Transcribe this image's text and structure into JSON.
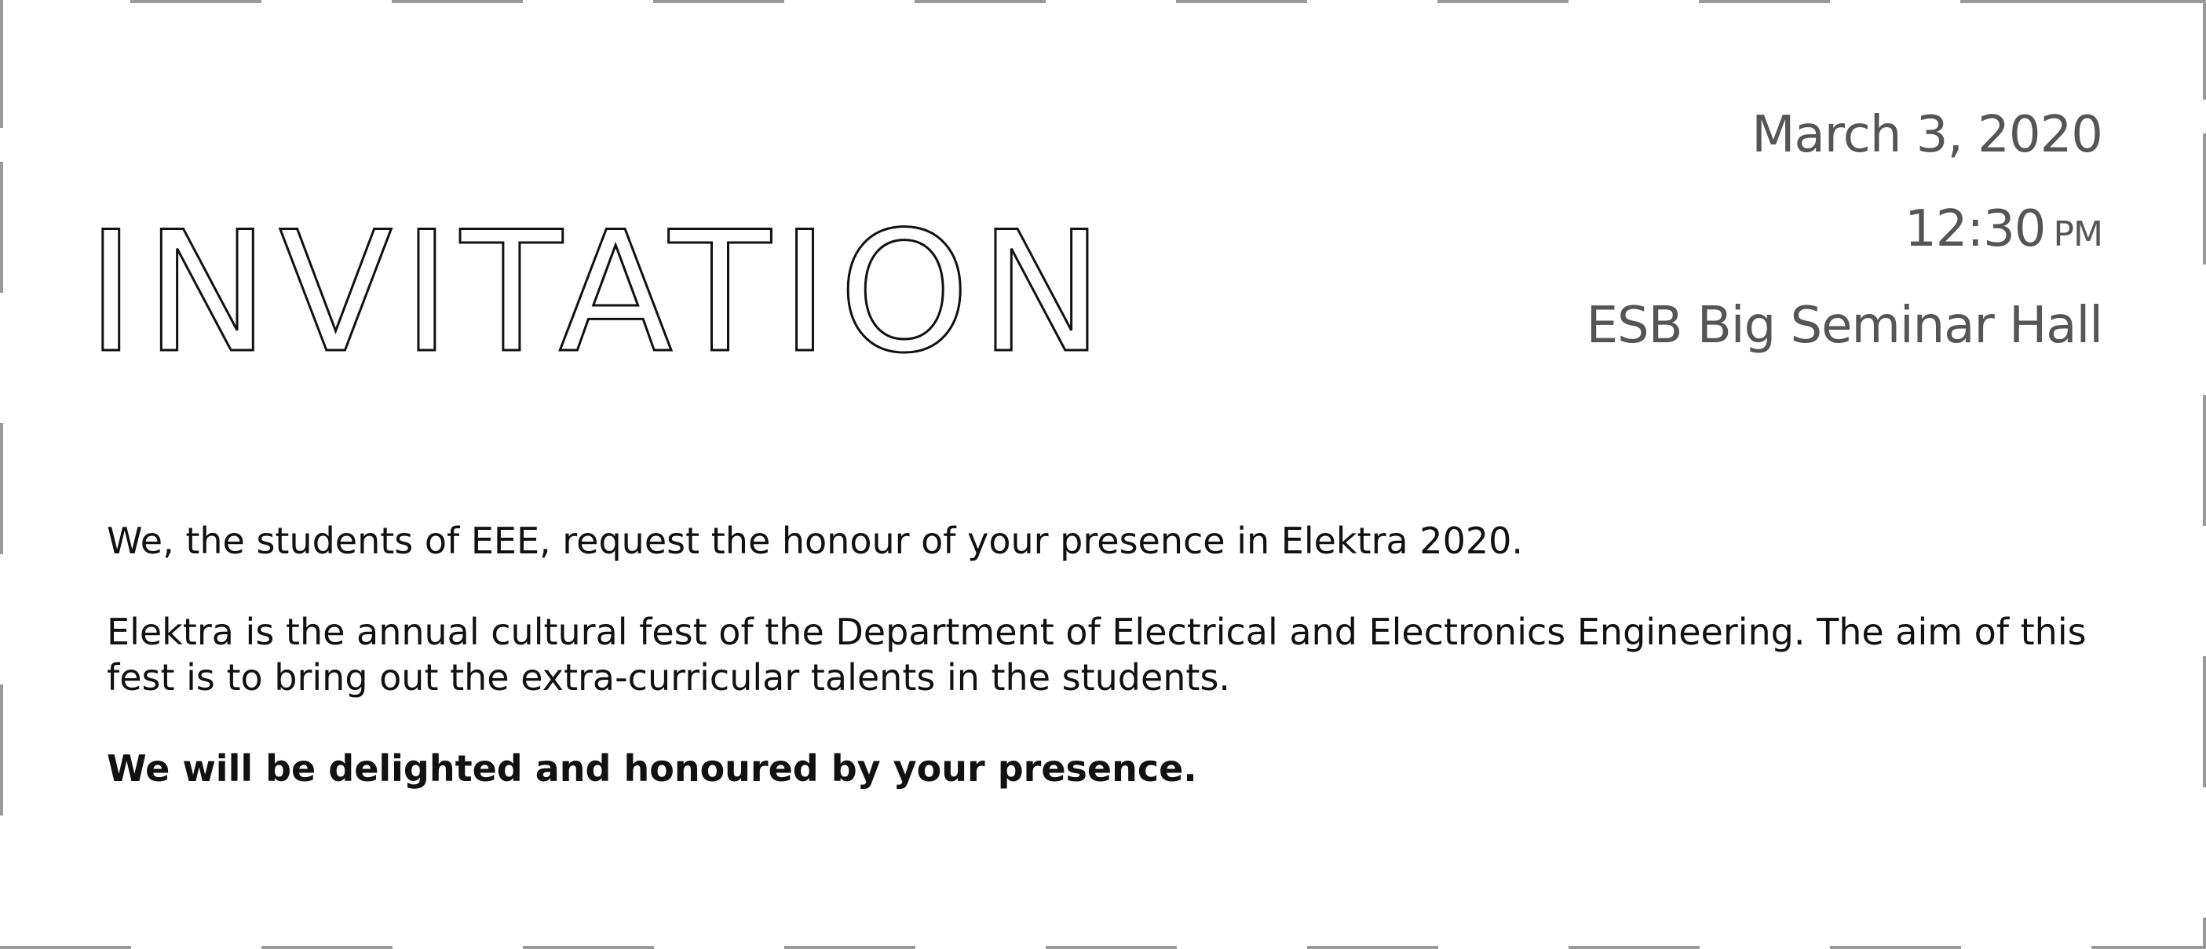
{
  "title": "INVITATION",
  "event": {
    "date": "March 3, 2020",
    "time": "12:30",
    "ampm": "PM",
    "venue": "ESB Big Seminar Hall"
  },
  "body": {
    "intro": "We, the students of EEE, request the honour of your presence in Elektra 2020.",
    "description": "Elektra is the annual cultural fest of the Department of Electrical and Electronics Engineering. The aim of this fest is to bring out the extra-curricular talents in the students.",
    "closing": "We will be delighted and honoured by your presence."
  }
}
